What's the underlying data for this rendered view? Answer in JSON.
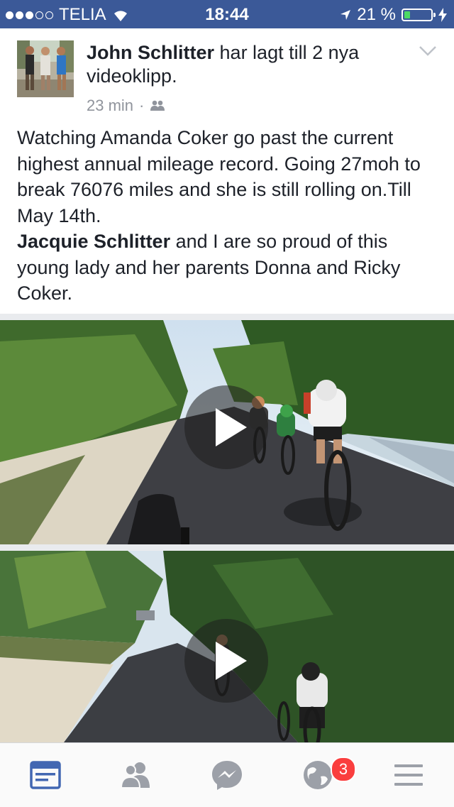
{
  "status_bar": {
    "carrier": "TELIA",
    "time": "18:44",
    "battery": "21 %",
    "battery_level": 0.21
  },
  "post": {
    "author": "John Schlitter",
    "action": " har lagt till 2 nya videoklipp.",
    "time_ago": "23 min",
    "separator": "·",
    "audience_icon": "friends-icon",
    "text_line1": "Watching Amanda Coker go past the current highest annual mileage record. Going 27moh to break 76076 miles and she is still rolling on.Till May 14th.",
    "mention": "Jacquie Schlitter",
    "text_line2": " and I are so proud of this young lady and her parents Donna and Ricky Coker."
  },
  "videos": [
    {
      "label": "video-1",
      "icon": "play-icon"
    },
    {
      "label": "video-2",
      "icon": "play-icon"
    }
  ],
  "tabbar": {
    "items": [
      "news-feed-icon",
      "friends-icon",
      "messenger-icon",
      "globe-icon",
      "menu-icon"
    ],
    "notifications_badge": "3",
    "active_color": "#4267b2",
    "inactive_color": "#9ca0a8"
  },
  "colors": {
    "brand": "#3b5998",
    "badge": "#fa3e3e"
  }
}
